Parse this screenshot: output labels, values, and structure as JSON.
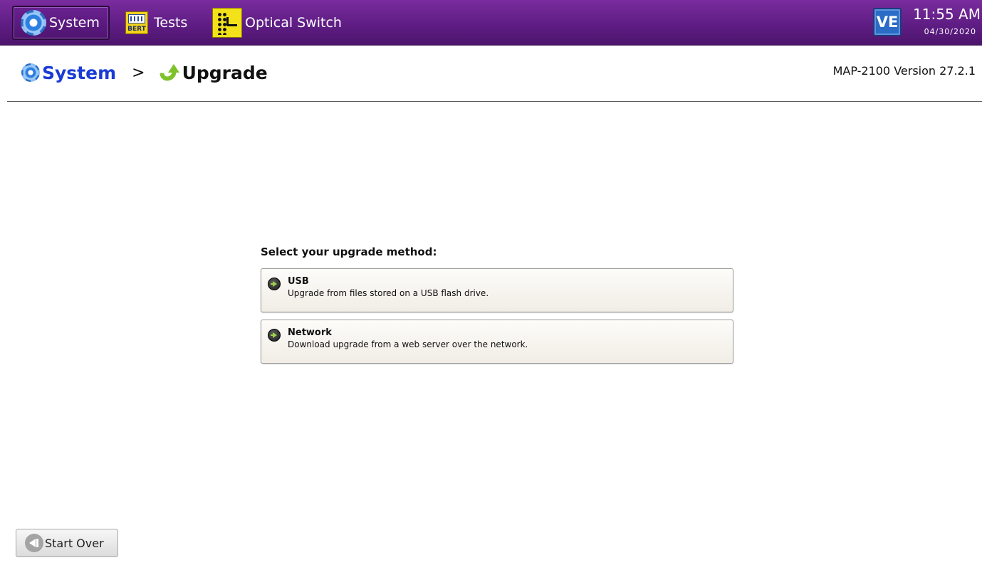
{
  "topbar": {
    "tabs": [
      {
        "label": "System",
        "icon": "gear-icon",
        "active": true
      },
      {
        "label": "Tests",
        "icon": "bert-icon",
        "icon_text": "BERT"
      },
      {
        "label": "Optical Switch",
        "icon": "optical-switch-icon"
      }
    ],
    "logo_text": "VE",
    "clock_time": "11:55 AM",
    "clock_date": "04/30/2020",
    "colors": {
      "bar": "#5f1d84",
      "accent": "#1a3bd6"
    }
  },
  "header": {
    "breadcrumb_root": "System",
    "breadcrumb_separator": ">",
    "breadcrumb_current": "Upgrade",
    "version": "MAP-2100 Version 27.2.1"
  },
  "main": {
    "prompt": "Select your upgrade method:",
    "options": [
      {
        "title": "USB",
        "description": "Upgrade from files stored on a USB flash drive."
      },
      {
        "title": "Network",
        "description": "Download upgrade from a web server over the network."
      }
    ]
  },
  "footer": {
    "start_over_label": "Start Over"
  }
}
